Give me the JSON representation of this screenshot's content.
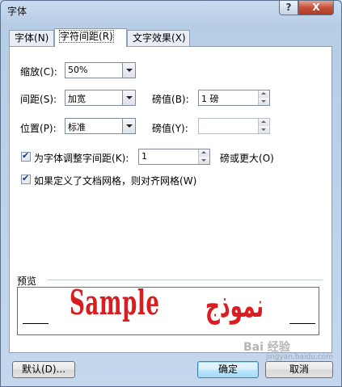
{
  "window": {
    "title": "字体",
    "help_label": "?",
    "close_label": "X"
  },
  "tabs": [
    {
      "label": "字体",
      "key": "(N)",
      "active": false
    },
    {
      "label": "字符间距",
      "key": "(R)",
      "active": true
    },
    {
      "label": "文字效果",
      "key": "(X)",
      "active": false
    }
  ],
  "scale": {
    "label": "缩放",
    "key": "(C)",
    "value": "50%"
  },
  "spacing": {
    "label": "间距",
    "key": "(S)",
    "value": "加宽",
    "by_label": "磅值",
    "by_key": "(B)",
    "by_value": "1 磅"
  },
  "position": {
    "label": "位置",
    "key": "(P)",
    "value": "标准",
    "by_label": "磅值",
    "by_key": "(Y)",
    "by_value": ""
  },
  "kerning": {
    "checked": true,
    "label": "为字体调整字间距",
    "key": "(K)",
    "value": "1",
    "suffix": "磅或更大",
    "suffix_key": "(O)"
  },
  "grid": {
    "checked": true,
    "label": "如果定义了文档网格，则对齐网格",
    "key": "(W)"
  },
  "preview": {
    "label": "预览",
    "sample_text": "Sample",
    "arabic_text": "نموذج",
    "text_color": "#d91d20"
  },
  "buttons": {
    "default_label": "默认",
    "default_key": "(D)...",
    "ok_label": "确定",
    "cancel_label": "取消"
  },
  "watermark": {
    "text": "Bai 经验",
    "sub": "jingyan.baidu.com"
  }
}
